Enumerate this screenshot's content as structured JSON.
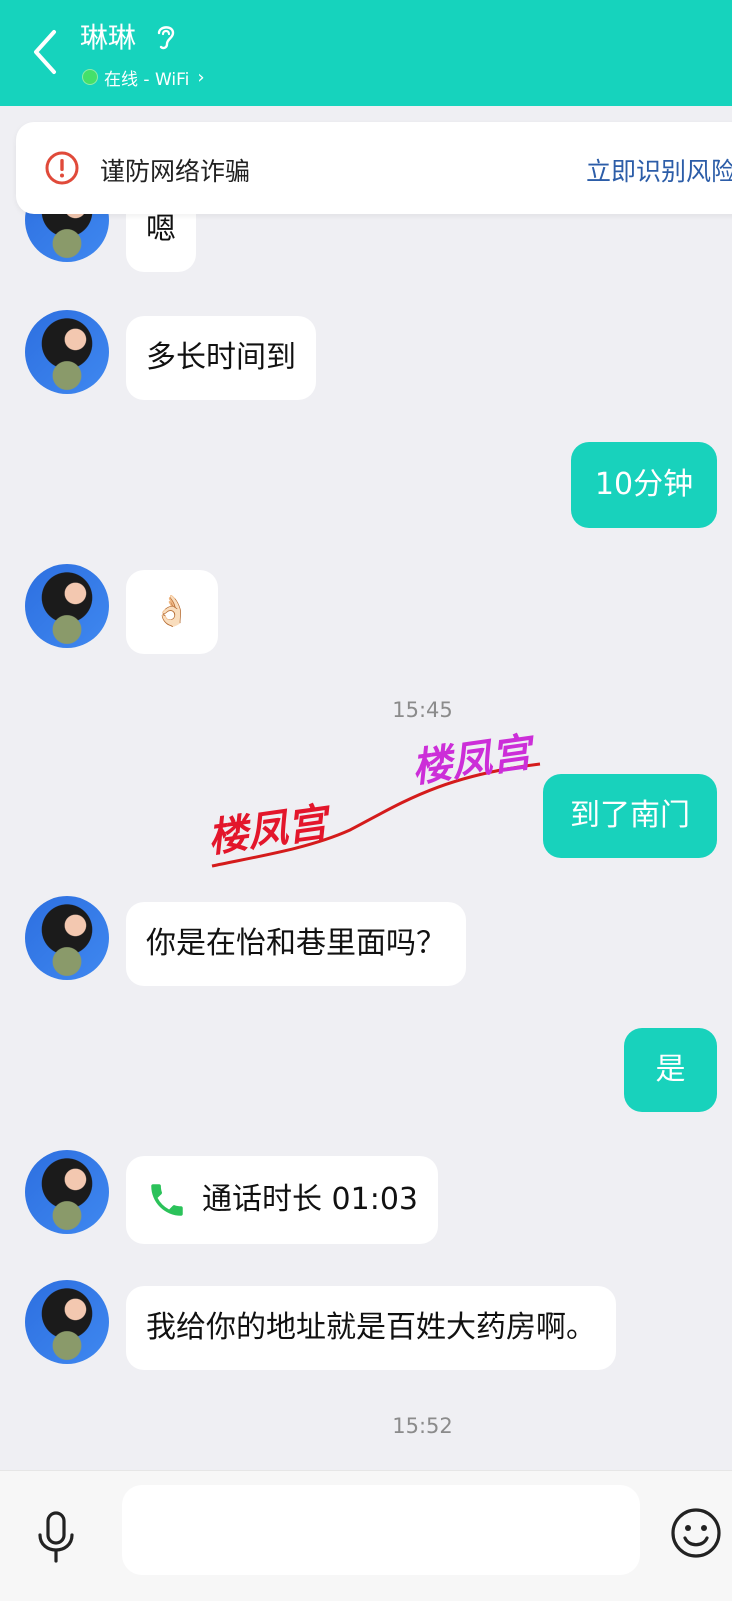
{
  "header": {
    "title": "琳琳",
    "status": "在线 - WiFi",
    "status_chevron": "›"
  },
  "fraud_notice": {
    "text": "谨防网络诈骗",
    "link": "立即识别风险"
  },
  "messages": [
    {
      "side": "in",
      "text": "嗯"
    },
    {
      "side": "in",
      "text": "多长时间到"
    },
    {
      "side": "out",
      "text": "10分钟"
    },
    {
      "side": "in",
      "text": "👌🏻"
    },
    {
      "time": "15:45"
    },
    {
      "side": "out",
      "text": "到了南门"
    },
    {
      "side": "in",
      "text": "你是在怡和巷里面吗？"
    },
    {
      "side": "out",
      "text": "是"
    },
    {
      "side": "in",
      "call": true,
      "text": "通话时长 01:03"
    },
    {
      "side": "in",
      "text": "我给你的地址就是百姓大药房啊。"
    },
    {
      "time": "15:52"
    }
  ],
  "watermark": {
    "text1": "楼凤宫",
    "text2": "楼凤宫"
  },
  "composer": {
    "placeholder": ""
  },
  "icons": {
    "back": "back-icon",
    "ear": "ear-icon",
    "alert": "alert-icon",
    "phone": "phone-icon",
    "mic": "mic-icon",
    "emoji": "emoji-icon"
  },
  "colors": {
    "accent": "#16d3bd",
    "link": "#2c5da8",
    "alert": "#e04a3a",
    "online": "#44e06a"
  }
}
